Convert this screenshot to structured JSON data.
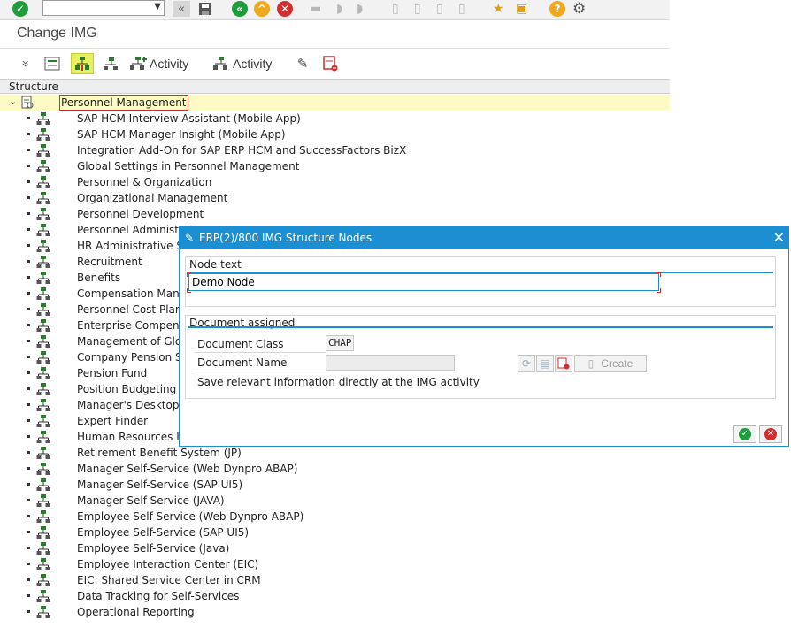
{
  "systoolbar": {
    "command_value": "",
    "icons": [
      "enter-icon",
      "back-icon",
      "save-icon",
      "back-arrow-icon",
      "exit-icon",
      "cancel-icon",
      "print-icon",
      "find-icon",
      "find-next-icon",
      "first-page-icon",
      "prev-page-icon",
      "next-page-icon",
      "last-page-icon",
      "bookmark-icon",
      "create-session-icon",
      "help-icon",
      "settings-icon"
    ]
  },
  "title": "Change IMG",
  "apptoolbar": {
    "activity1_label": "Activity",
    "activity2_label": "Activity"
  },
  "tree": {
    "header": "Structure",
    "root": "Personnel Management",
    "items": [
      "SAP HCM Interview Assistant (Mobile App)",
      "SAP HCM Manager Insight (Mobile App)",
      "Integration Add-On for SAP ERP HCM and SuccessFactors BizX",
      "Global Settings in Personnel Management",
      "Personnel & Organization",
      "Organizational Management",
      "Personnel Development",
      "Personnel Administrat",
      "HR Administrative Se",
      "Recruitment",
      "Benefits",
      "Compensation Manag",
      "Personnel Cost Plann",
      "Enterprise Compensa",
      "Management of Glob",
      "Company Pension Sc",
      "Pension Fund",
      "Position Budgeting ar",
      "Manager's Desktop",
      "Expert Finder",
      "Human Resources Inf",
      "Retirement Benefit System (JP)",
      "Manager Self-Service (Web Dynpro ABAP)",
      "Manager Self-Service (SAP UI5)",
      "Manager Self-Service (JAVA)",
      "Employee Self-Service (Web Dynpro ABAP)",
      "Employee Self-Service (SAP UI5)",
      "Employee Self-Service (Java)",
      "Employee Interaction Center (EIC)",
      "EIC: Shared Service Center in CRM",
      "Data Tracking for Self-Services",
      "Operational Reporting"
    ]
  },
  "dialog": {
    "title": "ERP(2)/800 IMG Structure Nodes",
    "node_text_group": "Node text",
    "node_text_value": "Demo Node",
    "doc_group": "Document assigned",
    "doc_class_label": "Document Class",
    "doc_class_value": "CHAP",
    "doc_name_label": "Document Name",
    "doc_name_value": "",
    "save_info": "Save relevant information directly at the IMG activity",
    "create_label": "Create"
  },
  "colors": {
    "accent": "#1b8fd1",
    "highlight": "#e8f060",
    "selected_row": "#fdfbc5",
    "confirm_green": "#1f9d3a",
    "cancel_red": "#d12e2e"
  }
}
